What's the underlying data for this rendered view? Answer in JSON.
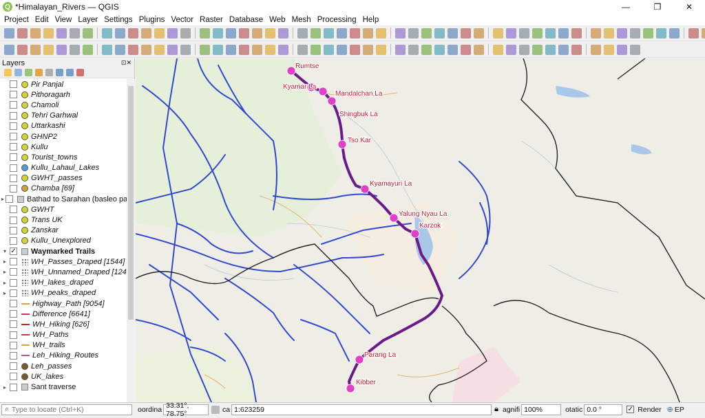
{
  "window": {
    "title": "*Himalayan_Rivers — QGIS",
    "min": "—",
    "max": "❐",
    "close": "✕"
  },
  "menu": [
    "Project",
    "Edit",
    "View",
    "Layer",
    "Settings",
    "Plugins",
    "Vector",
    "Raster",
    "Database",
    "Web",
    "Mesh",
    "Processing",
    "Help"
  ],
  "layers_panel": {
    "title": "Layers",
    "items": [
      {
        "label": "Pir Panjal",
        "sym": "#d4d430",
        "style": "i"
      },
      {
        "label": "Pithoragarh",
        "sym": "#d4d430",
        "style": "i"
      },
      {
        "label": "Chamoli",
        "sym": "#d4d430",
        "style": "i"
      },
      {
        "label": "Tehri Garhwal",
        "sym": "#d4d430",
        "style": "i"
      },
      {
        "label": "Uttarkashi",
        "sym": "#d4d430",
        "style": "i"
      },
      {
        "label": "GHNP2",
        "sym": "#d4d430",
        "style": "i"
      },
      {
        "label": "Kullu",
        "sym": "#d4d430",
        "style": "i"
      },
      {
        "label": "Tourist_towns",
        "sym": "#d4d430",
        "style": "i"
      },
      {
        "label": "Kullu_Lahaul_Lakes",
        "sym": "#4aa0d8",
        "style": "i"
      },
      {
        "label": "GWHT_passes",
        "sym": "#d4d430",
        "style": "i"
      },
      {
        "label": "Chamba [69]",
        "sym": "#c9a03a",
        "style": "i"
      },
      {
        "label": "Bathad to Sarahan (basleo pa",
        "sym": "group",
        "style": "n",
        "exp": "▸"
      },
      {
        "label": "GWHT",
        "sym": "#d4d430",
        "style": "i"
      },
      {
        "label": "Trans UK",
        "sym": "#d4d430",
        "style": "i"
      },
      {
        "label": "Zanskar",
        "sym": "#d4d430",
        "style": "i"
      },
      {
        "label": "Kullu_Unexplored",
        "sym": "#d4d430",
        "style": "i"
      },
      {
        "label": "Waymarked Trails",
        "sym": "group",
        "style": "b",
        "exp": "▾",
        "checked": true
      },
      {
        "label": "WH_Passes_Draped [1544]",
        "sym": "pts",
        "style": "i",
        "exp": "▸"
      },
      {
        "label": "WH_Unnamed_Draped [124",
        "sym": "pts",
        "style": "i",
        "exp": "▸"
      },
      {
        "label": "WH_lakes_draped",
        "sym": "pts",
        "style": "i",
        "exp": "▸"
      },
      {
        "label": "WH_peaks_draped",
        "sym": "pts",
        "style": "i",
        "exp": "▸"
      },
      {
        "label": "Highway_Path [9054]",
        "sym": "line:#e8a030",
        "style": "i"
      },
      {
        "label": "Difference [6641]",
        "sym": "line:#cc3366",
        "style": "i"
      },
      {
        "label": "WH_Hiking [626]",
        "sym": "line:#cc2222",
        "style": "i"
      },
      {
        "label": "WH_Paths",
        "sym": "line:#dd3333",
        "style": "i"
      },
      {
        "label": "WH_trails",
        "sym": "line:#e0a040",
        "style": "i"
      },
      {
        "label": "Leh_Hiking_Routes",
        "sym": "line:#aa55aa",
        "style": "i"
      },
      {
        "label": "Leh_passes",
        "sym": "#7a5a2a",
        "style": "i"
      },
      {
        "label": "UK_lakes",
        "sym": "#7a5a2a",
        "style": "i"
      },
      {
        "label": "Sant traverse",
        "sym": "group",
        "style": "n",
        "exp": "▸"
      }
    ]
  },
  "map_labels": [
    {
      "text": "Rumtse"
    },
    {
      "text": "Kyamar La"
    },
    {
      "text": "Mandalchan La"
    },
    {
      "text": "Shingbuk La"
    },
    {
      "text": "Tso Kar"
    },
    {
      "text": "Kyamayuri La"
    },
    {
      "text": "Yalung Nyau La"
    },
    {
      "text": "Karzok"
    },
    {
      "text": "Parang La"
    },
    {
      "text": "Kibber"
    }
  ],
  "status": {
    "locator_placeholder": "Type to locate (Ctrl+K)",
    "coord_label": "oordina",
    "coord_value": "33.31°, 78.75°",
    "scale_label": "ca",
    "scale_value": "1:623259",
    "magnifier_label": "agnifi",
    "magnifier_value": "100%",
    "rotation_label": "otatic",
    "rotation_value": "0.0 °",
    "render_label": "Render",
    "crs_label": "EP"
  },
  "colors": {
    "route": "#6a1b8a",
    "pass": "#e040c8",
    "road": "#3348d0",
    "border": "#222222"
  }
}
